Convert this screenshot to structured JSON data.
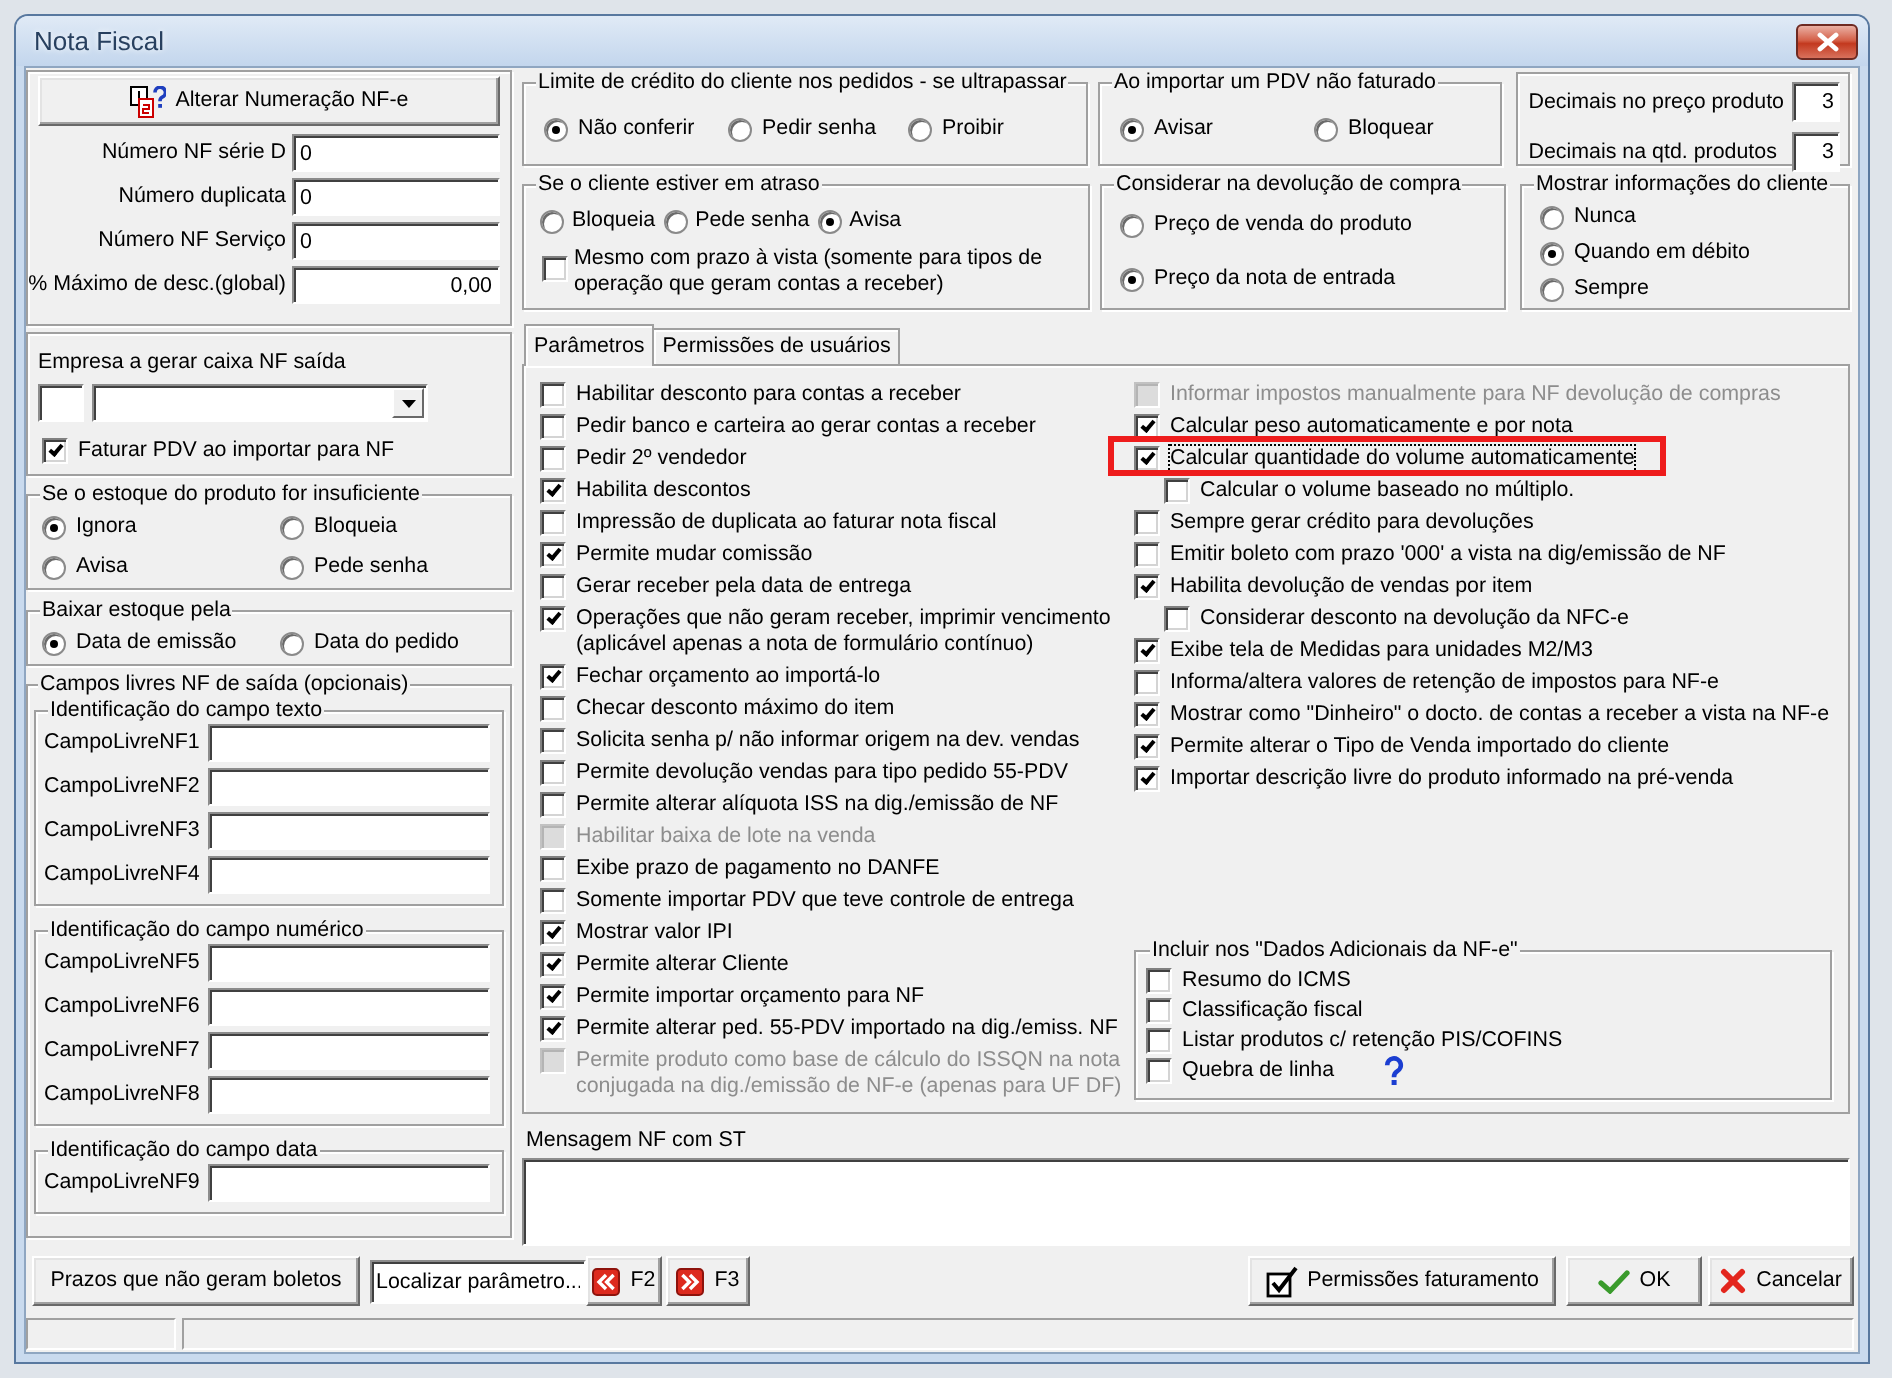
{
  "window": {
    "title": "Nota Fiscal"
  },
  "numbering": {
    "button": "Alterar Numeração NF-e",
    "fields": [
      {
        "label": "Número NF série D",
        "value": "0",
        "kind": "text"
      },
      {
        "label": "Número duplicata",
        "value": "0",
        "kind": "text"
      },
      {
        "label": "Número NF Serviço",
        "value": "0",
        "kind": "text"
      },
      {
        "label": "% Máximo de desc.(global)",
        "value": "0,00",
        "kind": "decimal"
      }
    ]
  },
  "cash_company": {
    "label": "Empresa a gerar caixa NF saída",
    "option": {
      "label": "Faturar PDV ao importar para NF",
      "checked": true
    }
  },
  "stock_insufficient": {
    "title": "Se o estoque do produto for insuficiente",
    "options": [
      {
        "label": "Ignora",
        "selected": true
      },
      {
        "label": "Bloqueia",
        "selected": false
      },
      {
        "label": "Avisa",
        "selected": false
      },
      {
        "label": "Pede senha",
        "selected": false
      }
    ]
  },
  "stock_lower_by": {
    "title": "Baixar estoque pela",
    "options": [
      {
        "label": "Data de emissão",
        "selected": true
      },
      {
        "label": "Data do pedido",
        "selected": false
      }
    ]
  },
  "free_fields": {
    "title": "Campos livres NF de saída (opcionais)",
    "groups": [
      {
        "title": "Identificação do campo texto",
        "fields": [
          {
            "label": "CampoLivreNF1"
          },
          {
            "label": "CampoLivreNF2"
          },
          {
            "label": "CampoLivreNF3"
          },
          {
            "label": "CampoLivreNF4"
          }
        ]
      },
      {
        "title": "Identificação do campo numérico",
        "fields": [
          {
            "label": "CampoLivreNF5"
          },
          {
            "label": "CampoLivreNF6"
          },
          {
            "label": "CampoLivreNF7"
          },
          {
            "label": "CampoLivreNF8"
          }
        ]
      },
      {
        "title": "Identificação do campo data",
        "fields": [
          {
            "label": "CampoLivreNF9"
          }
        ]
      }
    ]
  },
  "credit_limit": {
    "title": "Limite de crédito do cliente nos pedidos - se ultrapassar",
    "options": [
      {
        "label": "Não conferir",
        "selected": true
      },
      {
        "label": "Pedir senha",
        "selected": false
      },
      {
        "label": "Proibir",
        "selected": false
      }
    ]
  },
  "import_pdv": {
    "title": "Ao importar um PDV não faturado",
    "options": [
      {
        "label": "Avisar",
        "selected": true
      },
      {
        "label": "Bloquear",
        "selected": false
      }
    ]
  },
  "decimals": [
    {
      "label": "Decimais no preço produto",
      "value": "3"
    },
    {
      "label": "Decimais na qtd. produtos",
      "value": "3"
    }
  ],
  "overdue_client": {
    "title": "Se o cliente estiver em atraso",
    "options": [
      {
        "label": "Bloqueia",
        "selected": false
      },
      {
        "label": "Pede senha",
        "selected": false
      },
      {
        "label": "Avisa",
        "selected": true
      }
    ],
    "option": {
      "label": "Mesmo com prazo à vista (somente para tipos de operação que geram contas a receber)",
      "checked": false
    }
  },
  "purchase_return": {
    "title": "Considerar na devolução de compra",
    "options": [
      {
        "label": "Preço de venda do produto",
        "selected": false
      },
      {
        "label": "Preço da nota de entrada",
        "selected": true
      }
    ]
  },
  "client_info": {
    "title": "Mostrar informações do cliente",
    "options": [
      {
        "label": "Nunca",
        "selected": false
      },
      {
        "label": "Quando em débito",
        "selected": true
      },
      {
        "label": "Sempre",
        "selected": false
      }
    ]
  },
  "tabs": [
    {
      "label": "Parâmetros",
      "selected": true
    },
    {
      "label": "Permissões de usuários",
      "selected": false
    }
  ],
  "parameters": {
    "left": [
      {
        "label": "Habilitar desconto para contas a receber",
        "checked": false,
        "disabled": false
      },
      {
        "label": "Pedir banco e carteira ao gerar contas a receber",
        "checked": false,
        "disabled": false
      },
      {
        "label": "Pedir 2º vendedor",
        "checked": false,
        "disabled": false
      },
      {
        "label": "Habilita descontos",
        "checked": true,
        "disabled": false
      },
      {
        "label": "Impressão de duplicata ao faturar nota fiscal",
        "checked": false,
        "disabled": false
      },
      {
        "label": "Permite mudar comissão",
        "checked": true,
        "disabled": false
      },
      {
        "label": "Gerar receber pela data de entrega",
        "checked": false,
        "disabled": false
      },
      {
        "label": "Operações que não geram receber, imprimir vencimento (aplicável apenas a nota de formulário contínuo)",
        "checked": true,
        "disabled": false
      },
      {
        "label": "Fechar orçamento ao importá-lo",
        "checked": true,
        "disabled": false
      },
      {
        "label": "Checar desconto máximo do item",
        "checked": false,
        "disabled": false
      },
      {
        "label": "Solicita senha p/ não informar origem na dev. vendas",
        "checked": false,
        "disabled": false
      },
      {
        "label": "Permite devolução vendas para tipo pedido 55-PDV",
        "checked": false,
        "disabled": false
      },
      {
        "label": "Permite alterar alíquota ISS na dig./emissão de NF",
        "checked": false,
        "disabled": false
      },
      {
        "label": "Habilitar baixa de lote na venda",
        "checked": false,
        "disabled": true
      },
      {
        "label": "Exibe prazo de pagamento no DANFE",
        "checked": false,
        "disabled": false
      },
      {
        "label": "Somente importar PDV que teve controle de entrega",
        "checked": false,
        "disabled": false
      },
      {
        "label": "Mostrar valor IPI",
        "checked": true,
        "disabled": false
      },
      {
        "label": "Permite alterar Cliente",
        "checked": true,
        "disabled": false
      },
      {
        "label": "Permite importar orçamento para NF",
        "checked": true,
        "disabled": false
      },
      {
        "label": "Permite alterar ped. 55-PDV importado na dig./emiss. NF",
        "checked": true,
        "disabled": false
      },
      {
        "label": "Permite produto como base de cálculo do ISSQN na nota conjugada na dig./emissão de NF-e (apenas para UF DF)",
        "checked": false,
        "disabled": true
      }
    ],
    "right": [
      {
        "label": "Informar impostos manualmente para NF devolução de compras",
        "checked": false,
        "disabled": true
      },
      {
        "label": "Calcular peso automaticamente e por nota",
        "checked": true,
        "disabled": false
      },
      {
        "label": "Calcular quantidade do volume automaticamente",
        "checked": true,
        "disabled": false,
        "focused": true,
        "highlighted": true,
        "children": [
          {
            "label": "Calcular o volume baseado no múltiplo.",
            "checked": false,
            "disabled": false
          }
        ]
      },
      {
        "label": "Sempre gerar crédito para devoluções",
        "checked": false,
        "disabled": false
      },
      {
        "label": "Emitir boleto com prazo '000' a vista na dig/emissão de NF",
        "checked": false,
        "disabled": false
      },
      {
        "label": "Habilita devolução de vendas por item",
        "checked": true,
        "disabled": false,
        "children": [
          {
            "label": "Considerar desconto na devolução da NFC-e",
            "checked": false,
            "disabled": false
          }
        ]
      },
      {
        "label": "Exibe tela de Medidas para unidades M2/M3",
        "checked": true,
        "disabled": false
      },
      {
        "label": "Informa/altera valores de retenção de impostos para NF-e",
        "checked": false,
        "disabled": false
      },
      {
        "label": "Mostrar como \"Dinheiro\" o docto. de contas a receber a vista na NF-e",
        "checked": true,
        "disabled": false
      },
      {
        "label": "Permite alterar o Tipo de Venda importado do cliente",
        "checked": true,
        "disabled": false
      },
      {
        "label": "Importar descrição livre do produto informado na pré-venda",
        "checked": true,
        "disabled": false
      }
    ],
    "additional_data": {
      "title": "Incluir nos \"Dados Adicionais da NF-e\"",
      "items": [
        {
          "label": "Resumo do ICMS",
          "checked": false,
          "kind": "plain"
        },
        {
          "label": "Classificação fiscal",
          "checked": false,
          "kind": "plain"
        },
        {
          "label": "Listar produtos c/ retenção PIS/COFINS",
          "checked": false,
          "kind": "plain"
        },
        {
          "label": "Quebra de linha",
          "checked": false,
          "kind": "help"
        }
      ]
    }
  },
  "st_message": {
    "label": "Mensagem NF com ST"
  },
  "footer": {
    "deadlines_button": "Prazos que não geram boletos",
    "search": {
      "value": "Localizar parâmetro..."
    },
    "previous_button": "F2",
    "next_button": "F3",
    "permissions_button": "Permissões faturamento",
    "ok_button": "OK",
    "cancel_button": "Cancelar"
  }
}
